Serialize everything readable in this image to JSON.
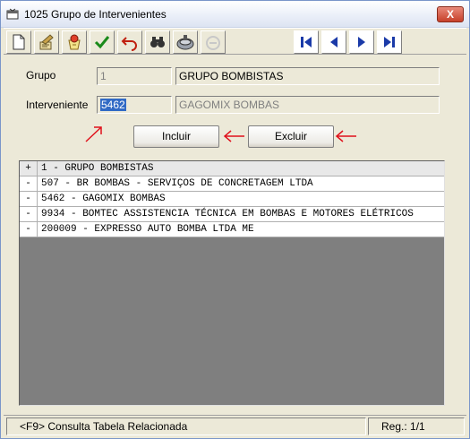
{
  "window": {
    "title": "1025 Grupo de Intervenientes",
    "close_symbol": "X"
  },
  "toolbar": {
    "buttons": [
      {
        "name": "new-document-icon"
      },
      {
        "name": "edit-brush-icon"
      },
      {
        "name": "clear-icon"
      },
      {
        "name": "confirm-check-icon"
      },
      {
        "name": "undo-icon"
      },
      {
        "name": "binoculars-icon"
      },
      {
        "name": "print-icon"
      },
      {
        "name": "disabled-icon"
      }
    ],
    "nav": [
      {
        "name": "first-record-icon"
      },
      {
        "name": "previous-record-icon"
      },
      {
        "name": "next-record-icon"
      },
      {
        "name": "last-record-icon"
      }
    ]
  },
  "form": {
    "grupo_label": "Grupo",
    "grupo_code": "1",
    "grupo_name": "GRUPO BOMBISTAS",
    "interveniente_label": "Interveniente",
    "interveniente_code": "5462",
    "interveniente_name": "GAGOMIX BOMBAS",
    "incluir_label": "Incluir",
    "excluir_label": "Excluir"
  },
  "annotations": {
    "color": "#e0101a"
  },
  "tree": [
    {
      "sign": "+",
      "text": "1 - GRUPO BOMBISTAS",
      "header": true
    },
    {
      "sign": "-",
      "text": "507 - BR BOMBAS - SERVIÇOS DE CONCRETAGEM LTDA"
    },
    {
      "sign": "-",
      "text": "5462 - GAGOMIX BOMBAS"
    },
    {
      "sign": "-",
      "text": "9934 - BOMTEC ASSISTENCIA TÉCNICA EM BOMBAS E MOTORES ELÉTRICOS"
    },
    {
      "sign": "-",
      "text": "200009 - EXPRESSO AUTO BOMBA LTDA ME"
    }
  ],
  "status": {
    "hint": "<F9> Consulta Tabela Relacionada",
    "record": "Reg.: 1/1"
  }
}
